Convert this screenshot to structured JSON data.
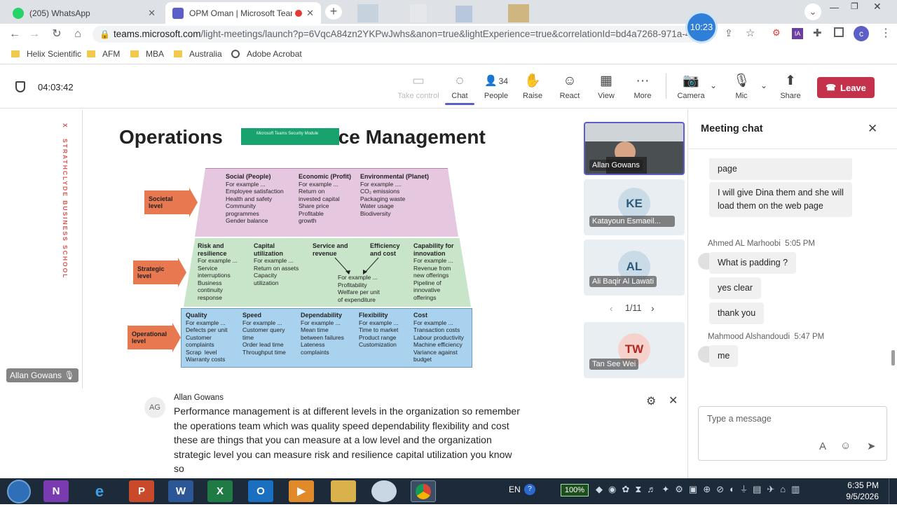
{
  "browser": {
    "tabs": [
      {
        "title": "(205) WhatsApp",
        "icon": "whatsapp-icon",
        "color": "#25d366"
      },
      {
        "title": "OPM Oman | Microsoft Team",
        "icon": "teams-icon",
        "color": "#5b5fc7"
      }
    ],
    "url_host": "teams.microsoft.com",
    "url_rest": "/light-meetings/launch?p=6VqcA84zn2YKPwJwhs&anon=true&lightExperience=true&correlationId=bd4a7268-971a-40d",
    "clock_badge": "10:23",
    "profile_initial": "c",
    "bookmarks": [
      "Helix Scientific",
      "AFM",
      "MBA",
      "Australia",
      "Adobe Acrobat"
    ]
  },
  "meeting": {
    "timer": "04:03:42",
    "toolbar": {
      "take_control": "Take control",
      "chat": "Chat",
      "people": "People",
      "people_count": "34",
      "raise": "Raise",
      "react": "React",
      "view": "View",
      "more": "More",
      "camera": "Camera",
      "mic": "Mic",
      "share": "Share",
      "leave": "Leave"
    }
  },
  "slide": {
    "title_left": "Operations ",
    "title_right": "nce Management",
    "overlay_text": "Microsoft Teams Security Module",
    "side_text": "STRATHCLYDE BUSINESS SCHOOL",
    "side_mark": "X",
    "levels": [
      {
        "label": "Societal level"
      },
      {
        "label": "Strategic level"
      },
      {
        "label": "Operational level"
      }
    ],
    "societal": [
      {
        "head": "Social (People)",
        "body": "For example ...\nEmployee satisfaction\nHealth and safety\nCommunity\nprogrammes\nGender balance"
      },
      {
        "head": "Economic (Profit)",
        "body": "For example ...\nReturn on\ninvested capital\nShare price\nProfitable\ngrowth"
      },
      {
        "head": "Environmental (Planet)",
        "body": "For example ....\nCO₂ emissions\nPackaging waste\nWater usage\nBiodiversity"
      }
    ],
    "strategic": [
      {
        "head": "Risk and\nresilience",
        "body": "For example ...\nService\ninterruptions\nBusiness\ncontinuity\nresponse"
      },
      {
        "head": "Capital\nutilization",
        "body": "For example ...\nReturn on assets\nCapacity\nutilization"
      },
      {
        "head": "Service and\nrevenue",
        "body": ""
      },
      {
        "head": "Efficiency\nand cost",
        "body": ""
      },
      {
        "head": "Capability for\ninnovation",
        "body": "For example ...\nRevenue from\nnew offerings\nPipeline of\ninnovative\nofferings"
      }
    ],
    "strategic_center": "For example ...\nProfitability\nWelfare per unit\nof expenditure",
    "operational": [
      {
        "head": "Quality",
        "body": "For example ...\nDefects per unit\nCustomer\ncomplaints\nScrap  level\nWarranty costs"
      },
      {
        "head": "Speed",
        "body": "For example ...\nCustomer query\ntime\nOrder lead time\nThroughput time"
      },
      {
        "head": "Dependability",
        "body": "For example ...\nMean time\nbetween failures\nLateness\ncomplaints"
      },
      {
        "head": "Flexibility",
        "body": "For example ...\nTime to market\nProduct range\nCustomization"
      },
      {
        "head": "Cost",
        "body": "For example ...\nTransaction costs\nLabour productivity\nMachine efficiency\nVariance against\nbudget"
      }
    ],
    "presenter_label": "Allan Gowans"
  },
  "participants": [
    {
      "name": "Allan Gowans",
      "initials": "",
      "video": true
    },
    {
      "name": "Katayoun Esmaeil...",
      "initials": "KE",
      "color": "#c9dbe6",
      "fg": "#2b5a7a"
    },
    {
      "name": "Ali Baqir Al Lawati",
      "initials": "AL",
      "color": "#c9dbe6",
      "fg": "#2b5a7a"
    },
    {
      "name": "Tan See Wei",
      "initials": "TW",
      "color": "#f6d2cc",
      "fg": "#b3261e"
    }
  ],
  "pager": "1/11",
  "caption": {
    "initials": "AG",
    "speaker": "Allan Gowans",
    "text": "Performance management is at different levels in the organization so remember the operations team which was quality speed dependability flexibility and cost these are things that you can measure at a low level and the organization strategic level you can measure risk and resilience capital utilization you know so"
  },
  "chat": {
    "title": "Meeting chat",
    "messages": [
      {
        "text": "page"
      },
      {
        "text": "I will give Dina them and she will load them on the web page"
      },
      {
        "author": "Ahmed AL Marhoobi",
        "time": "5:05 PM",
        "text": "What is padding ?"
      },
      {
        "text": "yes clear"
      },
      {
        "text": "thank you"
      },
      {
        "author": "Mahmood Alshandoudi",
        "time": "5:47 PM",
        "text": "me"
      }
    ],
    "placeholder": "Type a message"
  },
  "taskbar": {
    "apps": [
      "N",
      "e",
      "P",
      "W",
      "X",
      "O"
    ],
    "lang": "EN",
    "battery": "100%",
    "time": "6:35 PM",
    "date": "9/5/2026"
  }
}
